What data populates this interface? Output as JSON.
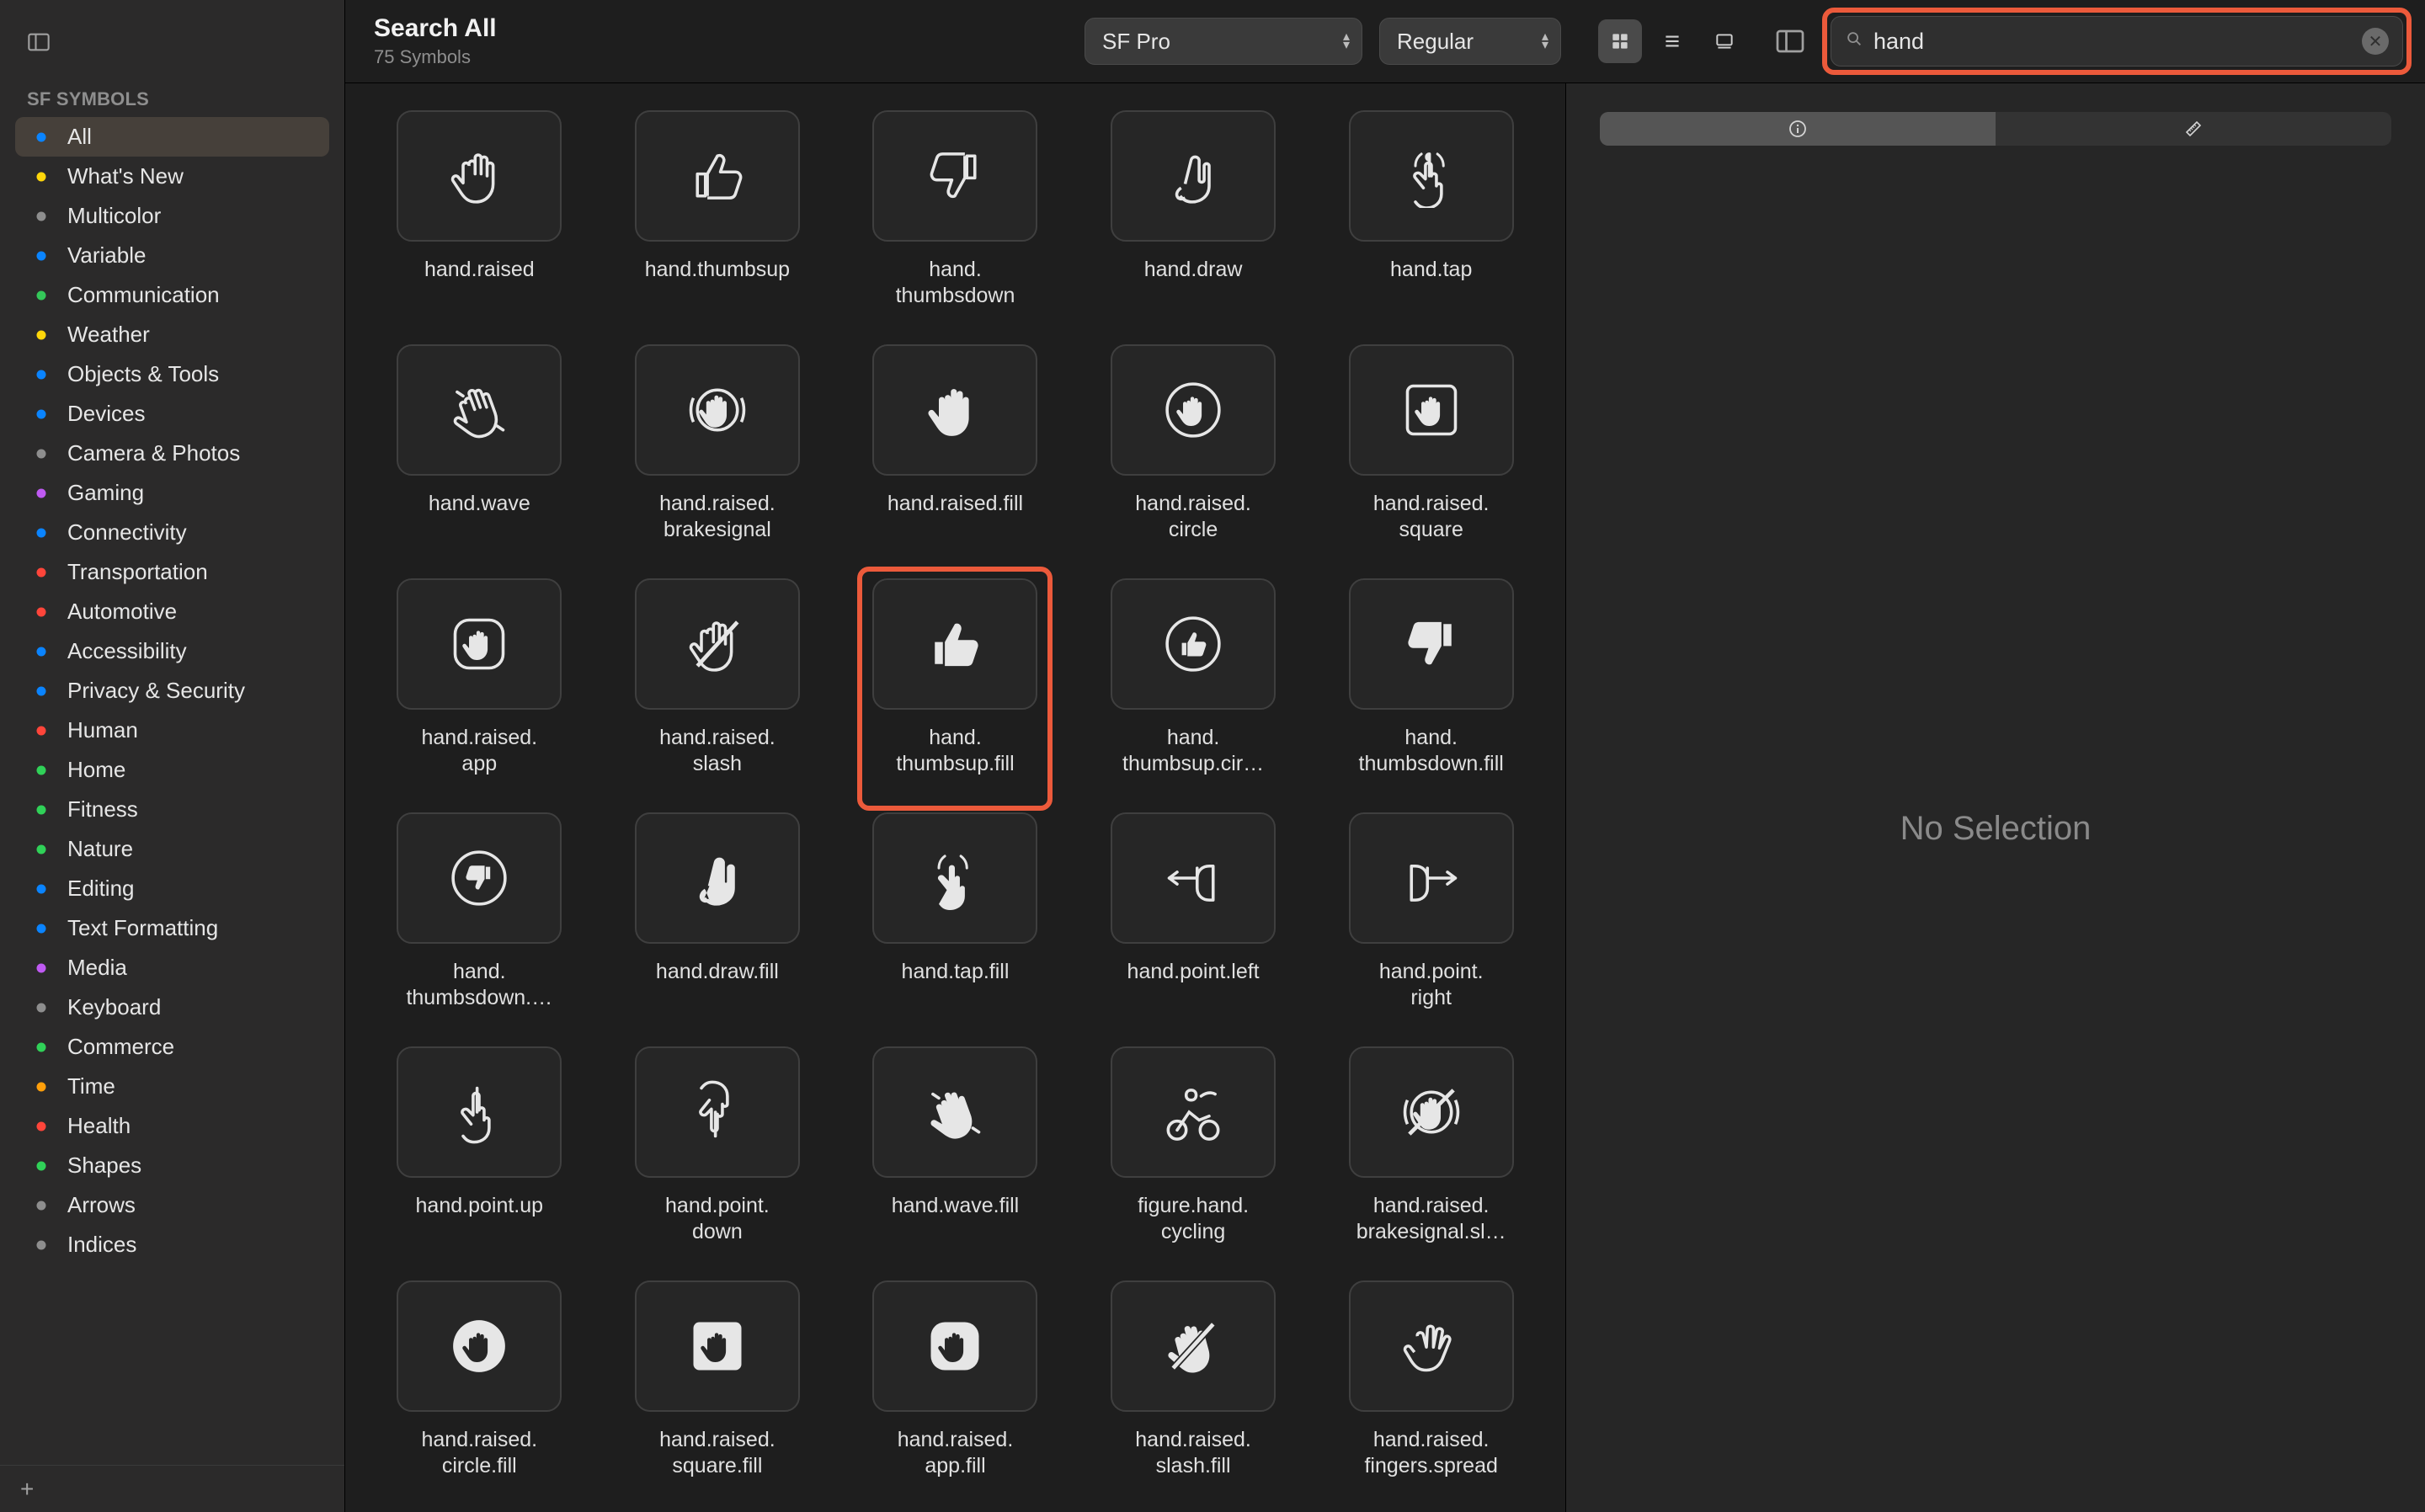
{
  "sidebar": {
    "header": "SF SYMBOLS",
    "items": [
      {
        "label": "All",
        "color": "#0a84ff",
        "icon": "grid"
      },
      {
        "label": "What's New",
        "color": "#ffd60a",
        "icon": "sparkles"
      },
      {
        "label": "Multicolor",
        "color": "#8e8e8e",
        "icon": "paint"
      },
      {
        "label": "Variable",
        "color": "#0a84ff",
        "icon": "slider"
      },
      {
        "label": "Communication",
        "color": "#34c759",
        "icon": "bubble"
      },
      {
        "label": "Weather",
        "color": "#ffd60a",
        "icon": "sun"
      },
      {
        "label": "Objects & Tools",
        "color": "#0a84ff",
        "icon": "folder"
      },
      {
        "label": "Devices",
        "color": "#0a84ff",
        "icon": "device"
      },
      {
        "label": "Camera & Photos",
        "color": "#8e8e8e",
        "icon": "camera"
      },
      {
        "label": "Gaming",
        "color": "#bf5af2",
        "icon": "game"
      },
      {
        "label": "Connectivity",
        "color": "#0a84ff",
        "icon": "antenna"
      },
      {
        "label": "Transportation",
        "color": "#ff453a",
        "icon": "car"
      },
      {
        "label": "Automotive",
        "color": "#ff453a",
        "icon": "steering"
      },
      {
        "label": "Accessibility",
        "color": "#0a84ff",
        "icon": "accessibility"
      },
      {
        "label": "Privacy & Security",
        "color": "#0a84ff",
        "icon": "lock"
      },
      {
        "label": "Human",
        "color": "#ff453a",
        "icon": "person"
      },
      {
        "label": "Home",
        "color": "#30d158",
        "icon": "house"
      },
      {
        "label": "Fitness",
        "color": "#30d158",
        "icon": "flame"
      },
      {
        "label": "Nature",
        "color": "#30d158",
        "icon": "leaf"
      },
      {
        "label": "Editing",
        "color": "#0a84ff",
        "icon": "pencil"
      },
      {
        "label": "Text Formatting",
        "color": "#0a84ff",
        "icon": "textformat"
      },
      {
        "label": "Media",
        "color": "#bf5af2",
        "icon": "play"
      },
      {
        "label": "Keyboard",
        "color": "#8e8e8e",
        "icon": "command"
      },
      {
        "label": "Commerce",
        "color": "#30d158",
        "icon": "cart"
      },
      {
        "label": "Time",
        "color": "#ff9f0a",
        "icon": "clock"
      },
      {
        "label": "Health",
        "color": "#ff453a",
        "icon": "heart"
      },
      {
        "label": "Shapes",
        "color": "#30d158",
        "icon": "shape"
      },
      {
        "label": "Arrows",
        "color": "#8e8e8e",
        "icon": "arrow"
      },
      {
        "label": "Indices",
        "color": "#8e8e8e",
        "icon": "number"
      }
    ],
    "selected_index": 0,
    "add_label": "+"
  },
  "header": {
    "title": "Search All",
    "subtitle": "75 Symbols",
    "font_select": "SF Pro",
    "weight_select": "Regular",
    "search_value": "hand"
  },
  "inspector": {
    "no_selection": "No Selection"
  },
  "symbols": [
    {
      "name": "hand.raised",
      "svg": "raised"
    },
    {
      "name": "hand.thumbsup",
      "svg": "thumbsup"
    },
    {
      "name": "hand. thumbsdown",
      "svg": "thumbsdown"
    },
    {
      "name": "hand.draw",
      "svg": "draw"
    },
    {
      "name": "hand.tap",
      "svg": "tap"
    },
    {
      "name": "hand.wave",
      "svg": "wave"
    },
    {
      "name": "hand.raised. brakesignal",
      "svg": "brakesignal"
    },
    {
      "name": "hand.raised.fill",
      "svg": "raised_fill"
    },
    {
      "name": "hand.raised. circle",
      "svg": "raised_circle"
    },
    {
      "name": "hand.raised. square",
      "svg": "raised_square"
    },
    {
      "name": "hand.raised. app",
      "svg": "raised_app"
    },
    {
      "name": "hand.raised. slash",
      "svg": "raised_slash"
    },
    {
      "name": "hand. thumbsup.fill",
      "svg": "thumbsup_fill",
      "highlight": true
    },
    {
      "name": "hand. thumbsup.cir…",
      "svg": "thumbsup_circle"
    },
    {
      "name": "hand. thumbsdown.fill",
      "svg": "thumbsdown_fill"
    },
    {
      "name": "hand. thumbsdown.…",
      "svg": "thumbsdown_circle"
    },
    {
      "name": "hand.draw.fill",
      "svg": "draw_fill"
    },
    {
      "name": "hand.tap.fill",
      "svg": "tap_fill"
    },
    {
      "name": "hand.point.left",
      "svg": "point_left"
    },
    {
      "name": "hand.point. right",
      "svg": "point_right"
    },
    {
      "name": "hand.point.up",
      "svg": "point_up"
    },
    {
      "name": "hand.point. down",
      "svg": "point_down"
    },
    {
      "name": "hand.wave.fill",
      "svg": "wave_fill"
    },
    {
      "name": "figure.hand. cycling",
      "svg": "cycling"
    },
    {
      "name": "hand.raised. brakesignal.sl…",
      "svg": "brakesignal_slash"
    },
    {
      "name": "hand.raised. circle.fill",
      "svg": "raised_circle_fill"
    },
    {
      "name": "hand.raised. square.fill",
      "svg": "raised_square_fill"
    },
    {
      "name": "hand.raised. app.fill",
      "svg": "raised_app_fill"
    },
    {
      "name": "hand.raised. slash.fill",
      "svg": "raised_slash_fill"
    },
    {
      "name": "hand.raised. fingers.spread",
      "svg": "fingers_spread"
    }
  ]
}
